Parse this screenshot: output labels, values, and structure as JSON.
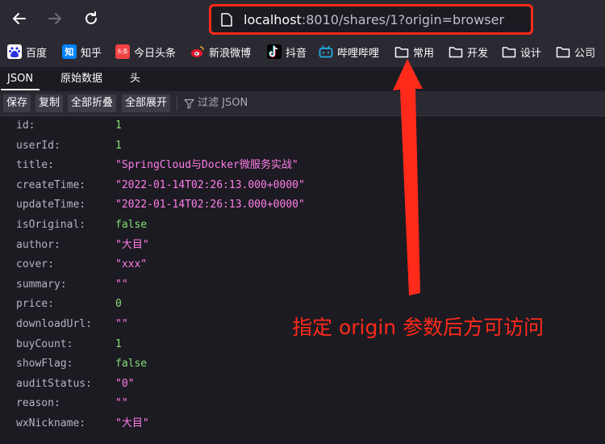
{
  "address_bar": {
    "url_host": "localhost",
    "url_rest": ":8010/shares/1?origin=browser"
  },
  "bookmarks": [
    {
      "label": "百度",
      "icon": "baidu-icon"
    },
    {
      "label": "知乎",
      "icon": "zhihu-icon",
      "icon_text": "知"
    },
    {
      "label": "今日头条",
      "icon": "toutiao-icon",
      "icon_text": "头条"
    },
    {
      "label": "新浪微博",
      "icon": "weibo-icon"
    },
    {
      "label": "抖音",
      "icon": "douyin-icon"
    },
    {
      "label": "哔哩哔哩",
      "icon": "bilibili-icon"
    },
    {
      "label": "常用",
      "icon": "folder-icon"
    },
    {
      "label": "开发",
      "icon": "folder-icon"
    },
    {
      "label": "设计",
      "icon": "folder-icon"
    },
    {
      "label": "公司",
      "icon": "folder-icon"
    }
  ],
  "viewer_tabs": [
    "JSON",
    "原始数据",
    "头"
  ],
  "toolbar": {
    "save": "保存",
    "copy": "复制",
    "collapse_all": "全部折叠",
    "expand_all": "全部展开",
    "filter_placeholder": "过滤 JSON"
  },
  "json": [
    {
      "key": "id:",
      "value": "1",
      "type": "num"
    },
    {
      "key": "userId:",
      "value": "1",
      "type": "num"
    },
    {
      "key": "title:",
      "value": "\"SpringCloud与Docker微服务实战\"",
      "type": "str"
    },
    {
      "key": "createTime:",
      "value": "\"2022-01-14T02:26:13.000+0000\"",
      "type": "str"
    },
    {
      "key": "updateTime:",
      "value": "\"2022-01-14T02:26:13.000+0000\"",
      "type": "str"
    },
    {
      "key": "isOriginal:",
      "value": "false",
      "type": "bool"
    },
    {
      "key": "author:",
      "value": "\"大目\"",
      "type": "str"
    },
    {
      "key": "cover:",
      "value": "\"xxx\"",
      "type": "str"
    },
    {
      "key": "summary:",
      "value": "\"\"",
      "type": "str"
    },
    {
      "key": "price:",
      "value": "0",
      "type": "num"
    },
    {
      "key": "downloadUrl:",
      "value": "\"\"",
      "type": "str"
    },
    {
      "key": "buyCount:",
      "value": "1",
      "type": "num"
    },
    {
      "key": "showFlag:",
      "value": "false",
      "type": "bool"
    },
    {
      "key": "auditStatus:",
      "value": "\"0\"",
      "type": "str"
    },
    {
      "key": "reason:",
      "value": "\"\"",
      "type": "str"
    },
    {
      "key": "wxNickname:",
      "value": "\"大目\"",
      "type": "str"
    }
  ],
  "annotation": "指定 origin 参数后方可访问",
  "colors": {
    "accent_red": "#ff2a1a",
    "json_string": "#ff7de9",
    "json_number": "#86de74",
    "background": "#1c1b22"
  }
}
